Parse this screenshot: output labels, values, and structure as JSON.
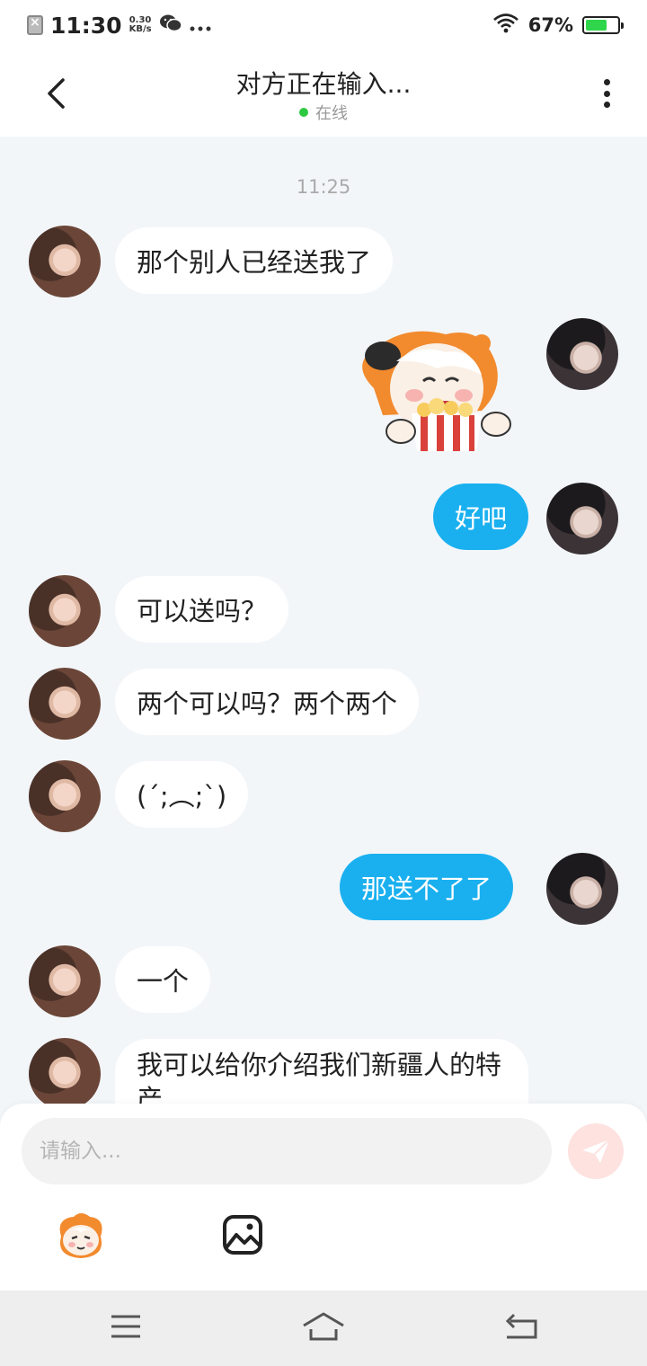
{
  "status_bar": {
    "time": "11:30",
    "speed_value": "0.30",
    "speed_unit": "KB/s",
    "battery_pct": "67%",
    "battery_level": 0.67
  },
  "header": {
    "title": "对方正在输入...",
    "status": "在线"
  },
  "chat": {
    "time_label": "11:25",
    "messages": [
      {
        "side": "in",
        "type": "text",
        "text": "那个别人已经送我了"
      },
      {
        "side": "out",
        "type": "sticker",
        "sticker": "popcorn-eating-character"
      },
      {
        "side": "out",
        "type": "text",
        "text": "好吧"
      },
      {
        "side": "in",
        "type": "text",
        "text": "可以送吗？"
      },
      {
        "side": "in",
        "type": "text",
        "text": "两个可以吗？两个两个"
      },
      {
        "side": "in",
        "type": "text",
        "text": "(´;︵;`)"
      },
      {
        "side": "out",
        "type": "text",
        "text": "那送不了了"
      },
      {
        "side": "in",
        "type": "text",
        "text": "一个"
      },
      {
        "side": "in",
        "type": "text",
        "text": "我可以给你介绍我们新疆人的特产"
      }
    ]
  },
  "input": {
    "placeholder": "请输入..."
  },
  "colors": {
    "outgoing_bubble": "#1ab0ef",
    "incoming_bubble": "#ffffff",
    "online_dot": "#2dc840",
    "send_button": "#fde2e0"
  },
  "icons": [
    "back-icon",
    "more-icon",
    "send-icon",
    "emoji-sticker-icon",
    "image-icon",
    "menu-icon",
    "home-icon",
    "back-nav-icon"
  ]
}
